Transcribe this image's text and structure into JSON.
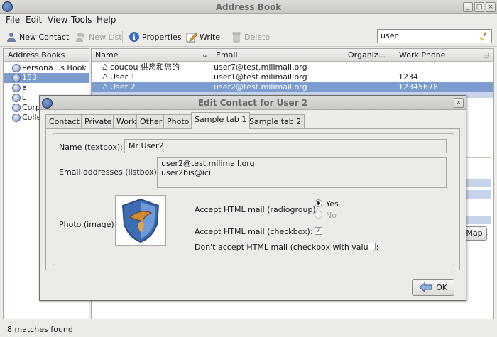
{
  "window": {
    "title": "Address Book"
  },
  "menu": {
    "file": "File",
    "edit": "Edit",
    "view": "View",
    "tools": "Tools",
    "help": "Help"
  },
  "toolbar": {
    "new_contact": "New Contact",
    "new_list": "New List",
    "properties": "Properties",
    "write": "Write",
    "delete": "Delete"
  },
  "search": {
    "value": "user"
  },
  "address_books": {
    "header": "Address Books",
    "items": [
      {
        "label": "Persona...s Book"
      },
      {
        "label": "153"
      },
      {
        "label": "a"
      },
      {
        "label": "c"
      },
      {
        "label": "Corp"
      },
      {
        "label": "Colle"
      }
    ]
  },
  "results": {
    "columns": {
      "name": "Name",
      "email": "Email",
      "org": "Organiz...",
      "phone": "Work Phone"
    },
    "rows": [
      {
        "name": "coucou 供您和您的",
        "email": "user7@test.milimail.org",
        "phone": ""
      },
      {
        "name": "User 1",
        "email": "user1@test.milimail.org",
        "phone": "1234"
      },
      {
        "name": "User 2",
        "email": "user2@test.milimail.org",
        "phone": "12345678"
      }
    ]
  },
  "status": {
    "text": "8 matches found"
  },
  "dialog": {
    "title": "Edit Contact for User 2",
    "tabs": [
      "Contact",
      "Private",
      "Work",
      "Other",
      "Photo",
      "Sample tab 1",
      "Sample tab 2"
    ],
    "name_label": "Name (textbox):",
    "name_value": "Mr User2",
    "email_label": "Email addresses (listbox):",
    "emails": [
      "user2@test.milimail.org",
      "user2bis@ici"
    ],
    "photo_label": "Photo (image):",
    "radiogroup_label": "Accept HTML mail (radiogroup):",
    "radio_yes": "Yes",
    "radio_no": "No",
    "checkbox_label": "Accept HTML mail (checkbox):",
    "checkbox2_label": "Don't accept HTML mail (checkbox with value):",
    "ok": "OK"
  },
  "background": {
    "map_button": "Map"
  }
}
